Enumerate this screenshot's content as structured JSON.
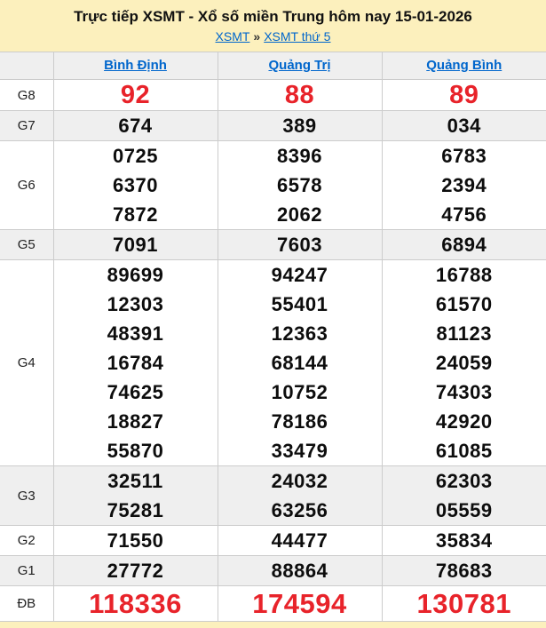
{
  "header": {
    "title": "Trực tiếp XSMT - Xổ số miền Trung hôm nay 15-01-2026",
    "breadcrumb": {
      "link1": "XSMT",
      "separator": "»",
      "link2": "XSMT thứ 5"
    }
  },
  "colors": {
    "page_background": "#fcf0bd",
    "link_blue": "#0066cc",
    "prize_red": "#e8232a",
    "row_shade": "#efefef"
  },
  "table": {
    "columns": [
      "Bình Định",
      "Quảng Trị",
      "Quảng Bình"
    ],
    "rows": [
      {
        "label": "G8",
        "style": "red-small",
        "values": [
          [
            "92"
          ],
          [
            "88"
          ],
          [
            "89"
          ]
        ]
      },
      {
        "label": "G7",
        "style": "normal",
        "values": [
          [
            "674"
          ],
          [
            "389"
          ],
          [
            "034"
          ]
        ]
      },
      {
        "label": "G6",
        "style": "normal",
        "values": [
          [
            "0725",
            "6370",
            "7872"
          ],
          [
            "8396",
            "6578",
            "2062"
          ],
          [
            "6783",
            "2394",
            "4756"
          ]
        ]
      },
      {
        "label": "G5",
        "style": "normal",
        "values": [
          [
            "7091"
          ],
          [
            "7603"
          ],
          [
            "6894"
          ]
        ]
      },
      {
        "label": "G4",
        "style": "normal",
        "values": [
          [
            "89699",
            "12303",
            "48391",
            "16784",
            "74625",
            "18827",
            "55870"
          ],
          [
            "94247",
            "55401",
            "12363",
            "68144",
            "10752",
            "78186",
            "33479"
          ],
          [
            "16788",
            "61570",
            "81123",
            "24059",
            "74303",
            "42920",
            "61085"
          ]
        ]
      },
      {
        "label": "G3",
        "style": "normal",
        "values": [
          [
            "32511",
            "75281"
          ],
          [
            "24032",
            "63256"
          ],
          [
            "62303",
            "05559"
          ]
        ]
      },
      {
        "label": "G2",
        "style": "normal",
        "values": [
          [
            "71550"
          ],
          [
            "44477"
          ],
          [
            "35834"
          ]
        ]
      },
      {
        "label": "G1",
        "style": "normal",
        "values": [
          [
            "27772"
          ],
          [
            "88864"
          ],
          [
            "78683"
          ]
        ]
      },
      {
        "label": "ĐB",
        "style": "red-large",
        "values": [
          [
            "118336"
          ],
          [
            "174594"
          ],
          [
            "130781"
          ]
        ]
      }
    ]
  }
}
